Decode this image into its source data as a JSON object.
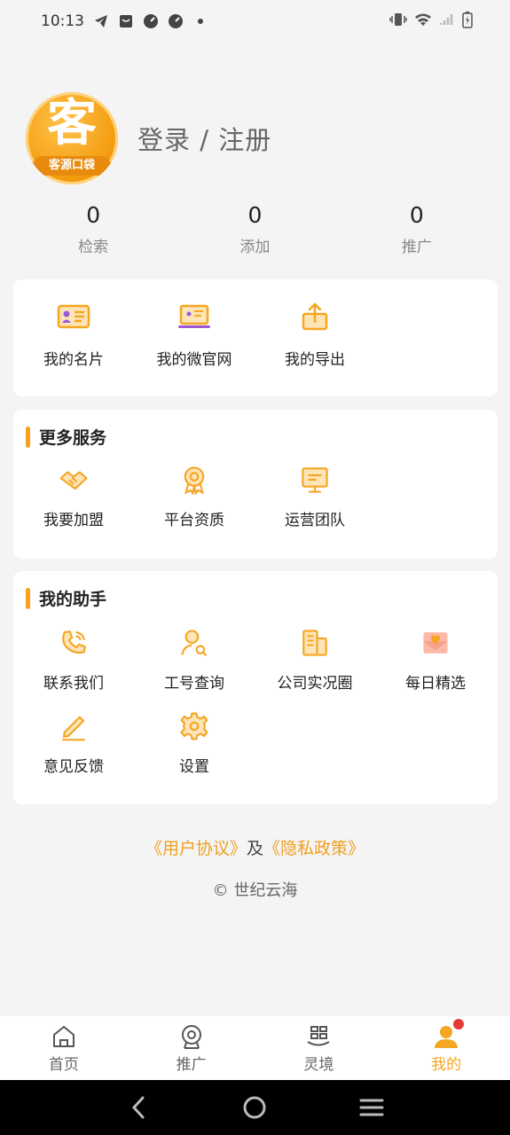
{
  "status_bar": {
    "time": "10:13",
    "left_icons": [
      "telegram-icon",
      "notification-icon",
      "gauge-icon",
      "gauge-icon",
      "dot-icon"
    ],
    "right_icons": [
      "vibrate-icon",
      "wifi-icon",
      "signal-icon",
      "battery-icon"
    ]
  },
  "profile": {
    "logo_text": "客源口袋",
    "login_label": "登录 / 注册"
  },
  "stats": [
    {
      "value": "0",
      "label": "检索"
    },
    {
      "value": "0",
      "label": "添加"
    },
    {
      "value": "0",
      "label": "推广"
    }
  ],
  "quick_links": [
    {
      "label": "我的名片",
      "icon": "business-card-icon"
    },
    {
      "label": "我的微官网",
      "icon": "laptop-site-icon"
    },
    {
      "label": "我的导出",
      "icon": "export-icon"
    }
  ],
  "more_services": {
    "title": "更多服务",
    "items": [
      {
        "label": "我要加盟",
        "icon": "handshake-icon"
      },
      {
        "label": "平台资质",
        "icon": "certificate-icon"
      },
      {
        "label": "运营团队",
        "icon": "team-board-icon"
      }
    ]
  },
  "assistant": {
    "title": "我的助手",
    "items": [
      {
        "label": "联系我们",
        "icon": "phone-icon"
      },
      {
        "label": "工号查询",
        "icon": "user-search-icon"
      },
      {
        "label": "公司实况圈",
        "icon": "building-icon"
      },
      {
        "label": "每日精选",
        "icon": "heart-mail-icon"
      },
      {
        "label": "意见反馈",
        "icon": "pencil-icon"
      },
      {
        "label": "设置",
        "icon": "gear-icon"
      }
    ]
  },
  "footer": {
    "user_agreement": "《用户协议》",
    "and": "及",
    "privacy_policy": "《隐私政策》",
    "copyright": "© 世纪云海"
  },
  "bottom_nav": [
    {
      "label": "首页",
      "icon": "home-icon"
    },
    {
      "label": "推广",
      "icon": "promote-icon"
    },
    {
      "label": "灵境",
      "icon": "grid-refresh-icon"
    },
    {
      "label": "我的",
      "icon": "user-icon"
    }
  ],
  "colors": {
    "accent": "#f5a623",
    "badge": "#e53935",
    "background": "#f4f4f4"
  }
}
